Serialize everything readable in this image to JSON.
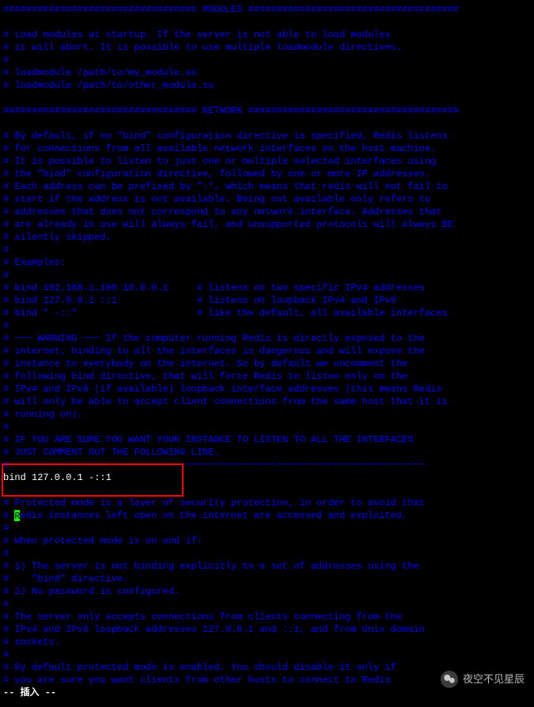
{
  "lines": [
    "################################## MODULES #####################################",
    "",
    "# Load modules at startup. If the server is not able to load modules",
    "# it will abort. It is possible to use multiple loadmodule directives.",
    "#",
    "# loadmodule /path/to/my_module.so",
    "# loadmodule /path/to/other_module.so",
    "",
    "################################## NETWORK #####################################",
    "",
    "# By default, if no \"bind\" configuration directive is specified, Redis listens",
    "# for connections from all available network interfaces on the host machine.",
    "# It is possible to listen to just one or multiple selected interfaces using",
    "# the \"bind\" configuration directive, followed by one or more IP addresses.",
    "# Each address can be prefixed by \"-\", which means that redis will not fail to",
    "# start if the address is not available. Being not available only refers to",
    "# addresses that does not correspond to any network interface. Addresses that",
    "# are already in use will always fail, and unsupported protocols will always BE",
    "# silently skipped.",
    "#",
    "# Examples:",
    "#",
    "# bind 192.168.1.100 10.0.0.1     # listens on two specific IPv4 addresses",
    "# bind 127.0.0.1 ::1              # listens on loopback IPv4 and IPv6",
    "# bind * -::*                     # like the default, all available interfaces",
    "#",
    "# ~~~ WARNING ~~~ If the computer running Redis is directly exposed to the",
    "# internet, binding to all the interfaces is dangerous and will expose the",
    "# instance to everybody on the internet. So by default we uncomment the",
    "# following bind directive, that will force Redis to listen only on the",
    "# IPv4 and IPv6 (if available) loopback interface addresses (this means Redis",
    "# will only be able to accept client connections from the same host that it is",
    "# running on).",
    "#",
    "# IF YOU ARE SURE YOU WANT YOUR INSTANCE TO LISTEN TO ALL THE INTERFACES",
    "# JUST COMMENT OUT THE FOLLOWING LINE.",
    "# ~~~~~~~~~~~~~~~~~~~~~~~~~~~~~~~~~~~~~~~~~~~~~~~~~~~~~~~~~~~~~~~~~~~~~~~~",
    "bind 127.0.0.1 -::1",
    "",
    "# Protected mode is a layer of security protection, in order to avoid that",
    "# Redis instances left open on the internet are accessed and exploited.",
    "#",
    "# When protected mode is on and if:",
    "#",
    "# 1) The server is not binding explicitly to a set of addresses using the",
    "#    \"bind\" directive.",
    "# 2) No password is configured.",
    "#",
    "# The server only accepts connections from clients connecting from the",
    "# IPv4 and IPv6 loopback addresses 127.0.0.1 and ::1, and from Unix domain",
    "# sockets.",
    "#",
    "# By default protected mode is enabled. You should disable it only if",
    "# you are sure you want clients from other hosts to connect to Redis"
  ],
  "active_line_index": 37,
  "cursor_line_index": 40,
  "status": "-- 插入 --",
  "watermark": "夜空不见星辰"
}
